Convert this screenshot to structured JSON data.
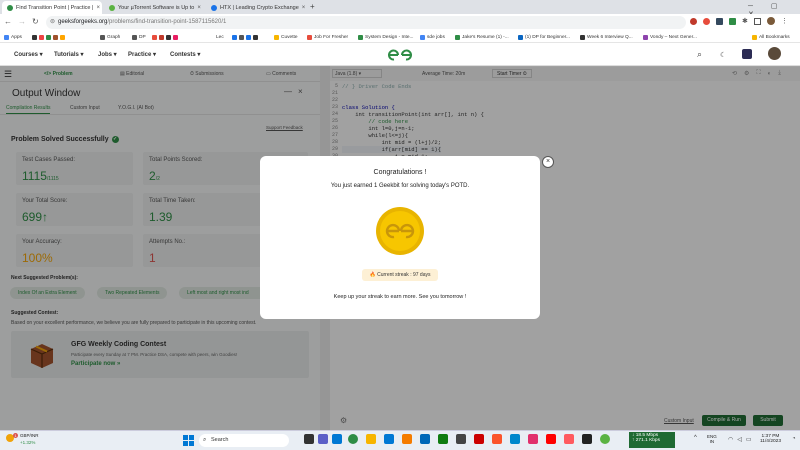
{
  "browser": {
    "tabs": [
      {
        "title": "Find Transition Point | Practice |",
        "color": "#2f8d46",
        "active": true
      },
      {
        "title": "Your µTorrent Software is Up to",
        "color": "#5bb342",
        "active": false
      },
      {
        "title": "HTX | Leading Crypto Exchange",
        "color": "#1a73e8",
        "active": false
      }
    ],
    "new_tab": "+",
    "url_domain": "geeksforgeeks.org",
    "url_path": "/problems/find-transition-point-1587115620/1",
    "bookmarks": [
      "Apps",
      "Graph",
      "DP",
      "Lec",
      "Cuvette",
      "Job For Fresher",
      "System Design - Inte...",
      "sde jobs",
      "Jake's Resume (1) -...",
      "(1) DP for Beginner...",
      "Week 6 Interview Q...",
      "Vondy – Next Gener..."
    ],
    "all_bookmarks": "All Bookmarks"
  },
  "gfg_nav": {
    "items": [
      "Courses",
      "Tutorials",
      "Jobs",
      "Practice",
      "Contests"
    ]
  },
  "left_panel": {
    "tabs": [
      "Problem",
      "Editorial",
      "Submissions",
      "Comments"
    ],
    "output_window_title": "Output Window",
    "subtabs": [
      "Compilation Results",
      "Custom Input",
      "Y.O.G.I. (AI Bot)"
    ],
    "report_link": "Report An Issue",
    "feedback_link": "Support Feedback",
    "result_title": "Problem Solved Successfully",
    "stats": [
      {
        "label": "Test Cases Passed:",
        "value": "1115",
        "sub": "/1115"
      },
      {
        "label": "Total Points Scored:",
        "value": "2",
        "sub": "/2"
      },
      {
        "label": "Your Total Score:",
        "value": "699",
        "sub": "↑"
      },
      {
        "label": "Total Time Taken:",
        "value": "1.39",
        "sub": ""
      },
      {
        "label": "Your Accuracy:",
        "value": "100%",
        "sub": ""
      },
      {
        "label": "Attempts No.:",
        "value": "1",
        "sub": ""
      }
    ],
    "next_suggested_label": "Next Suggested Problem(s):",
    "suggestions": [
      "Index Of an Extra Element",
      "Two Repeated Elements",
      "Left most and right most ind"
    ],
    "suggested_contest_label": "Suggested Contest:",
    "contest_desc": "Based on your excellent performance, we believe you are fully prepared to participate in this upcoming contest.",
    "contest_title": "GFG Weekly Coding Contest",
    "contest_sub": "Participate every Sunday at 7 PM. Practice DSA, compete with peers, win Goodies!",
    "participate": "Participate now »"
  },
  "editor": {
    "language": "Java (1.8)",
    "avg_time": "Average Time: 20m",
    "start_timer": "Start Timer",
    "line_numbers": [
      "5",
      "21",
      "22",
      "23",
      "24",
      "25",
      "26",
      "27",
      "28",
      "29",
      "30"
    ],
    "code_lines": [
      "// } Driver Code Ends",
      "",
      "",
      "class Solution {",
      "    int transitionPoint(int arr[], int n) {",
      "        // code here",
      "        int l=0,j=n-1;",
      "        while(l<=j){",
      "            int mid = (l+j)/2;",
      "            if(arr[mid] == 1){",
      "                j = mid-1;"
    ],
    "custom_input": "Custom Input",
    "compile_run": "Compile & Run",
    "submit": "Submit"
  },
  "modal": {
    "title": "Congratulations !",
    "message": "You just earned 1 Geekbit for solving today's POTD.",
    "coin_logo": "GfG",
    "streak": "Current streak : 97 days",
    "footer": "Keep up your streak to earn more. See you tomorrow !",
    "close": "×"
  },
  "taskbar": {
    "weather_label": "GBP/INR",
    "weather_value": "+1.32%",
    "search": "Search",
    "net_down": "↓ 18.5 Mbps",
    "net_up": "↑ 271.1 Kbps",
    "lang": "ENG",
    "lang2": "IN",
    "time": "1:37 PM",
    "date": "11/4/2023",
    "notif_badge": "1"
  },
  "colors": {
    "brand": "#2f8d46",
    "accuracy": "#f0a30a",
    "attempts": "#d9534f"
  }
}
